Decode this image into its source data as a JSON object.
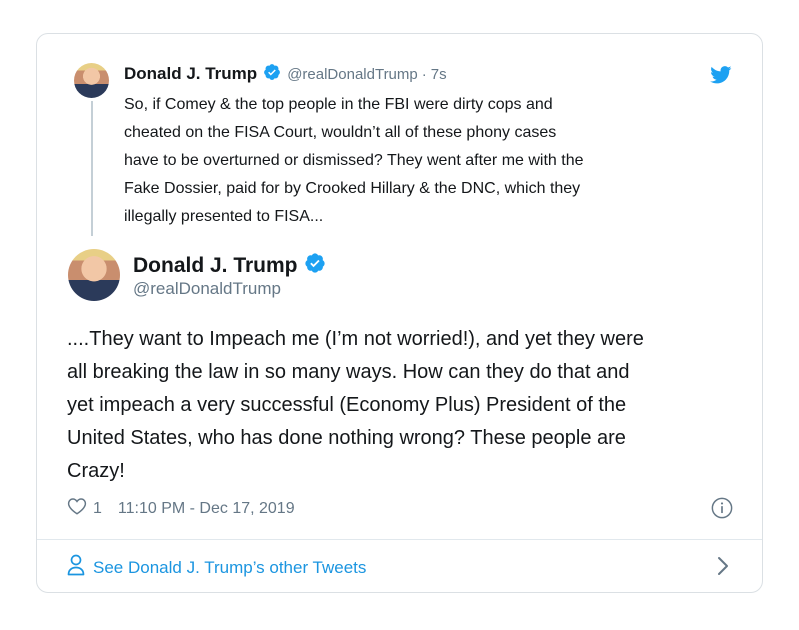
{
  "quoted_tweet": {
    "name": "Donald J. Trump",
    "handle": "@realDonaldTrump",
    "separator": "·",
    "time": "7s",
    "text": "So, if Comey & the top people in the FBI were dirty cops and\ncheated on the FISA Court, wouldn’t all of these phony cases\nhave to be overturned or dismissed? They went after me with the\nFake Dossier, paid for by Crooked Hillary & the DNC, which they\nillegally presented to FISA..."
  },
  "main_tweet": {
    "name": "Donald J. Trump",
    "handle": "@realDonaldTrump",
    "text": "....They want to Impeach me (I’m not worried!), and yet they were\nall breaking the law in so many ways. How can they do that and\nyet impeach a very successful (Economy Plus) President of the\nUnited States, who has done nothing wrong? These people are\nCrazy!",
    "likes": "1",
    "timestamp": "11:10 PM - Dec 17, 2019"
  },
  "footer": {
    "label": "See Donald J. Trump’s other Tweets"
  },
  "icons": {
    "verified": "verified-badge-icon",
    "bird": "twitter-bird-icon",
    "heart": "heart-icon",
    "info": "info-icon",
    "person": "person-icon",
    "chevron": "chevron-right-icon"
  },
  "colors": {
    "accent": "#1da1f2",
    "link": "#1b95e0",
    "secondary_text": "#657786",
    "border": "#dbe0e4"
  }
}
